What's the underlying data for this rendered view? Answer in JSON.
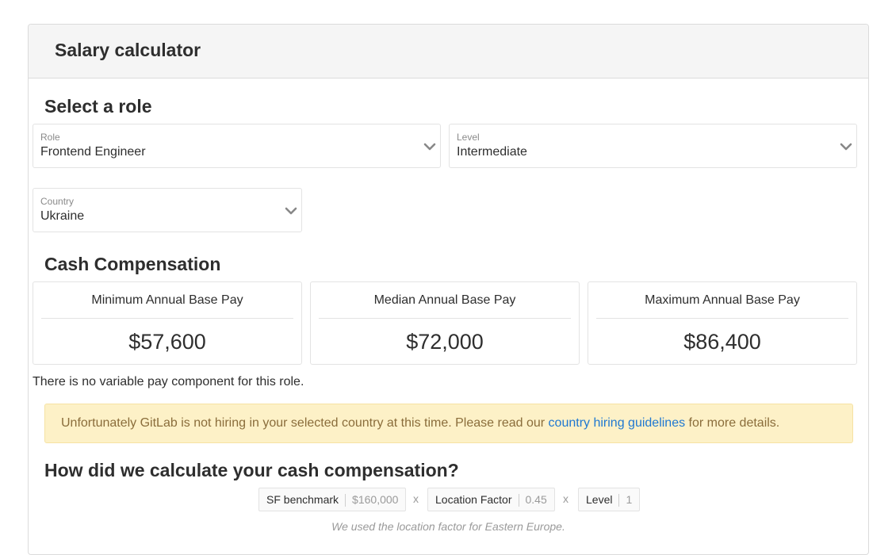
{
  "header": {
    "title": "Salary calculator"
  },
  "select_role": {
    "heading": "Select a role",
    "role": {
      "label": "Role",
      "value": "Frontend Engineer",
      "icon": "chevron-down-icon"
    },
    "level": {
      "label": "Level",
      "value": "Intermediate",
      "icon": "chevron-down-icon"
    },
    "country": {
      "label": "Country",
      "value": "Ukraine",
      "icon": "chevron-down-icon"
    }
  },
  "cash": {
    "heading": "Cash Compensation",
    "boxes": [
      {
        "title": "Minimum Annual Base Pay",
        "amount": "$57,600"
      },
      {
        "title": "Median Annual Base Pay",
        "amount": "$72,000"
      },
      {
        "title": "Maximum Annual Base Pay",
        "amount": "$86,400"
      }
    ],
    "variable_note": "There is no variable pay component for this role."
  },
  "alert": {
    "text_before": "Unfortunately GitLab is not hiring in your selected country at this time. Please read our ",
    "link_text": "country hiring guidelines",
    "text_after": " for more details."
  },
  "calculation": {
    "heading": "How did we calculate your cash compensation?",
    "factors": [
      {
        "name": "SF benchmark",
        "value": "$160,000"
      },
      {
        "name": "Location Factor",
        "value": "0.45"
      },
      {
        "name": "Level",
        "value": "1"
      }
    ],
    "operator": "x",
    "footnote": "We used the location factor for Eastern Europe."
  },
  "colors": {
    "alert_bg": "#fdf1c7",
    "alert_text": "#8a6d3b",
    "link": "#1f78d1"
  }
}
